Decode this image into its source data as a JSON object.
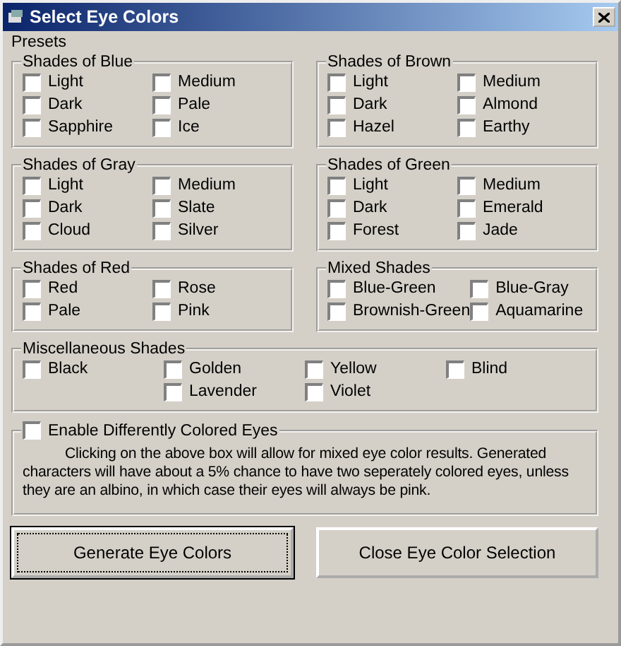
{
  "window": {
    "title": "Select Eye Colors"
  },
  "presets_label": "Presets",
  "groups": [
    {
      "title": "Shades of Blue",
      "columns": [
        [
          {
            "label": "Light",
            "checked": false
          },
          {
            "label": "Dark",
            "checked": false
          },
          {
            "label": "Sapphire",
            "checked": false
          }
        ],
        [
          {
            "label": "Medium",
            "checked": false
          },
          {
            "label": "Pale",
            "checked": false
          },
          {
            "label": "Ice",
            "checked": false
          }
        ]
      ]
    },
    {
      "title": "Shades of Brown",
      "columns": [
        [
          {
            "label": "Light",
            "checked": false
          },
          {
            "label": "Dark",
            "checked": false
          },
          {
            "label": "Hazel",
            "checked": false
          }
        ],
        [
          {
            "label": "Medium",
            "checked": false
          },
          {
            "label": "Almond",
            "checked": false
          },
          {
            "label": "Earthy",
            "checked": false
          }
        ]
      ]
    },
    {
      "title": "Shades of Gray",
      "columns": [
        [
          {
            "label": "Light",
            "checked": false
          },
          {
            "label": "Dark",
            "checked": false
          },
          {
            "label": "Cloud",
            "checked": false
          }
        ],
        [
          {
            "label": "Medium",
            "checked": false
          },
          {
            "label": "Slate",
            "checked": false
          },
          {
            "label": "Silver",
            "checked": false
          }
        ]
      ]
    },
    {
      "title": "Shades of Green",
      "columns": [
        [
          {
            "label": "Light",
            "checked": false
          },
          {
            "label": "Dark",
            "checked": false
          },
          {
            "label": "Forest",
            "checked": false
          }
        ],
        [
          {
            "label": "Medium",
            "checked": false
          },
          {
            "label": "Emerald",
            "checked": false
          },
          {
            "label": "Jade",
            "checked": false
          }
        ]
      ]
    },
    {
      "title": "Shades of Red",
      "columns": [
        [
          {
            "label": "Red",
            "checked": false
          },
          {
            "label": "Pale",
            "checked": false
          }
        ],
        [
          {
            "label": "Rose",
            "checked": false
          },
          {
            "label": "Pink",
            "checked": false
          }
        ]
      ]
    },
    {
      "title": "Mixed Shades",
      "columns": [
        [
          {
            "label": "Blue-Green",
            "checked": false
          },
          {
            "label": "Brownish-Green",
            "checked": false
          }
        ],
        [
          {
            "label": "Blue-Gray",
            "checked": false
          },
          {
            "label": "Aquamarine",
            "checked": false
          }
        ]
      ]
    },
    {
      "title": "Miscellaneous Shades",
      "wide": true,
      "columns": [
        [
          {
            "label": "Black",
            "checked": false
          }
        ],
        [
          {
            "label": "Golden",
            "checked": false
          },
          {
            "label": "Lavender",
            "checked": false
          }
        ],
        [
          {
            "label": "Yellow",
            "checked": false
          },
          {
            "label": "Violet",
            "checked": false
          }
        ],
        [
          {
            "label": "Blind",
            "checked": false
          }
        ]
      ]
    }
  ],
  "different_eyes": {
    "label": "Enable Differently Colored Eyes",
    "checked": false,
    "description": "Clicking on the above box will allow for mixed eye color results.  Generated characters will have about a 5% chance to have two seperately colored eyes, unless they are an albino, in which case their eyes will always be pink."
  },
  "buttons": [
    {
      "label": "Generate Eye Colors",
      "focused": true
    },
    {
      "label": "Close Eye Color Selection",
      "focused": false
    }
  ]
}
